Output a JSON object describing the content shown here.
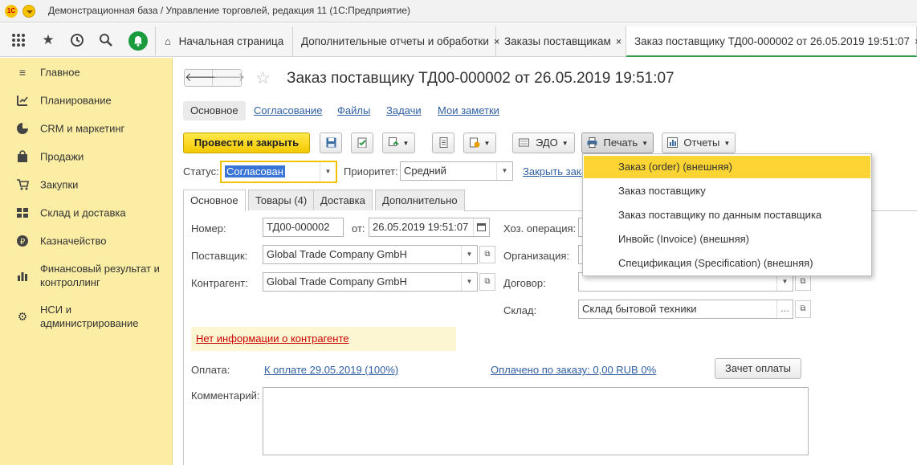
{
  "window": {
    "title": "Демонстрационная база / Управление торговлей, редакция 11  (1С:Предприятие)",
    "logo": "1С"
  },
  "topbar": {
    "icons": [
      "apps-grid-icon",
      "star-icon",
      "history-icon",
      "search-icon",
      "bell-icon"
    ],
    "tabs": [
      {
        "label": "Начальная страница",
        "icon": "home-icon"
      },
      {
        "label": "Дополнительные отчеты и обработки",
        "close": "×"
      },
      {
        "label": "Заказы поставщикам",
        "close": "×"
      },
      {
        "label": "Заказ поставщику ТД00-000002 от 26.05.2019 19:51:07",
        "close": "×"
      }
    ]
  },
  "sidebar": {
    "items": [
      {
        "label": "Главное",
        "icon": "menu-icon"
      },
      {
        "label": "Планирование",
        "icon": "planning-icon"
      },
      {
        "label": "CRM и маркетинг",
        "icon": "pie-chart-icon"
      },
      {
        "label": "Продажи",
        "icon": "shopping-bag-icon"
      },
      {
        "label": "Закупки",
        "icon": "cart-icon"
      },
      {
        "label": "Склад и доставка",
        "icon": "warehouse-icon"
      },
      {
        "label": "Казначейство",
        "icon": "coin-icon"
      },
      {
        "label": "Финансовый результат и контроллинг",
        "icon": "bar-chart-icon"
      },
      {
        "label": "НСИ и администрирование",
        "icon": "gear-icon"
      }
    ]
  },
  "document": {
    "nav": {
      "back": "🡐",
      "forward": "🡒"
    },
    "star": "☆",
    "title": "Заказ поставщику ТД00-000002 от 26.05.2019 19:51:07",
    "subtabs": [
      "Основное",
      "Согласование",
      "Файлы",
      "Задачи",
      "Мои заметки"
    ]
  },
  "toolbar": {
    "post_close": "Провести и закрыть",
    "edo": "ЭДО",
    "print": "Печать",
    "reports": "Отчеты"
  },
  "status": {
    "label": "Статус:",
    "value": "Согласован",
    "priority_label": "Приоритет:",
    "priority_value": "Средний",
    "close_link": "Закрыть заказ"
  },
  "form_tabs": [
    "Основное",
    "Товары (4)",
    "Доставка",
    "Дополнительно"
  ],
  "fields": {
    "number_label": "Номер:",
    "number": "ТД00-000002",
    "date_label": "от:",
    "date": "26.05.2019 19:51:07",
    "supplier_label": "Поставщик:",
    "supplier": "Global Trade Company GmbH",
    "counterparty_label": "Контрагент:",
    "counterparty": "Global Trade Company GmbH",
    "operation_label": "Хоз. операция:",
    "organization_label": "Организация:",
    "contract_label": "Договор:",
    "contract": "",
    "warehouse_label": "Склад:",
    "warehouse": "Склад бытовой техники",
    "warning": "Нет информации о контрагенте",
    "payment_label": "Оплата:",
    "payment_link": "К оплате 29.05.2019 (100%)",
    "paid_link": "Оплачено по заказу: 0,00 RUB  0%",
    "offset_button": "Зачет оплаты",
    "comment_label": "Комментарий:",
    "comment": ""
  },
  "print_menu": {
    "items": [
      "Заказ (order) (внешняя)",
      "Заказ поставщику",
      "Заказ поставщику по данным поставщика",
      "Инвойс (Invoice) (внешняя)",
      "Спецификация (Specification) (внешняя)"
    ],
    "selected_index": 0
  },
  "colors": {
    "sidebar": "#fbeda4",
    "accent_yellow": "#f5c900",
    "bell_green": "#1a9b3e",
    "link": "#2f5fa3",
    "warning": "#cc0000"
  }
}
